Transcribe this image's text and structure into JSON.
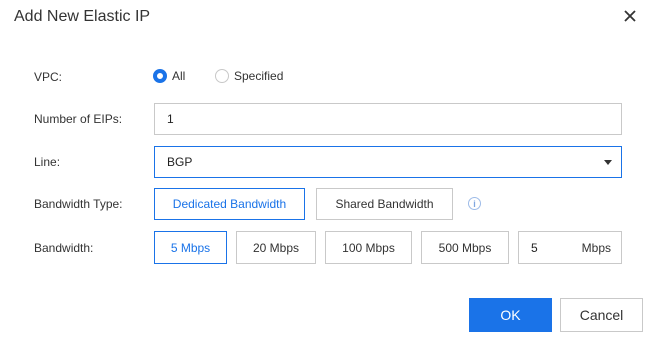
{
  "dialog": {
    "title": "Add New Elastic IP"
  },
  "vpc": {
    "label": "VPC:",
    "options": [
      "All",
      "Specified"
    ],
    "selected": "All"
  },
  "eips": {
    "label": "Number of EIPs:",
    "value": "1"
  },
  "line": {
    "label": "Line:",
    "value": "BGP"
  },
  "bandwidth_type": {
    "label": "Bandwidth Type:",
    "options": [
      "Dedicated Bandwidth",
      "Shared Bandwidth"
    ],
    "selected": "Dedicated Bandwidth",
    "info_glyph": "i"
  },
  "bandwidth": {
    "label": "Bandwidth:",
    "options": [
      "5 Mbps",
      "20 Mbps",
      "100 Mbps",
      "500 Mbps"
    ],
    "selected": "5 Mbps",
    "custom_value": "5",
    "unit": "Mbps"
  },
  "footer": {
    "ok_label": "OK",
    "cancel_label": "Cancel"
  },
  "colors": {
    "accent": "#1a73e8"
  }
}
